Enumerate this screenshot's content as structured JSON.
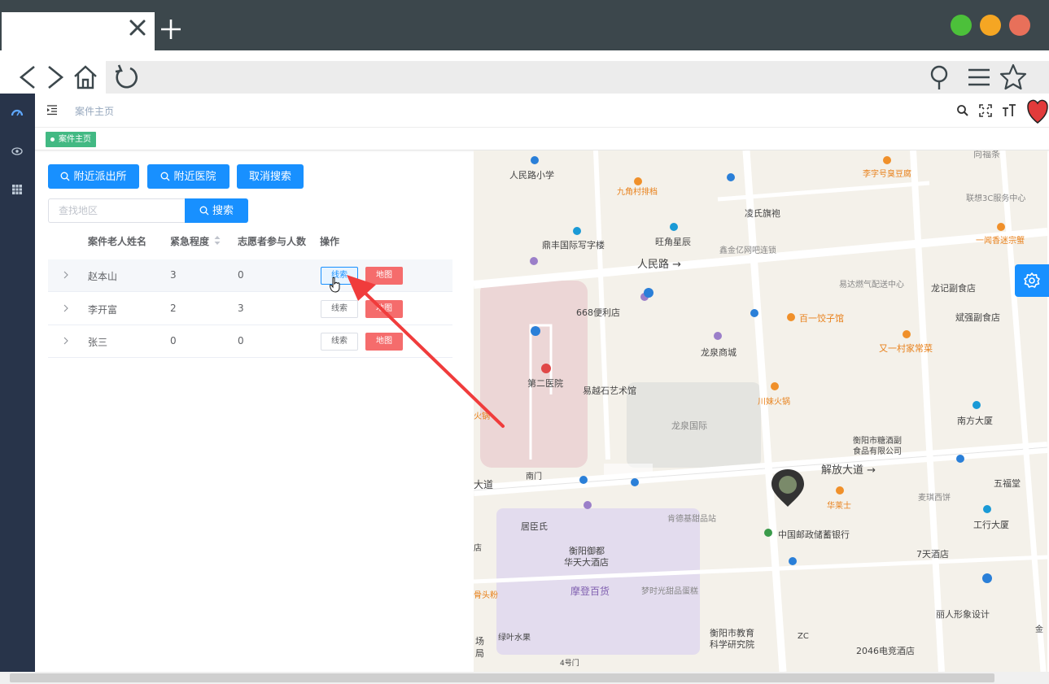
{
  "browser": {
    "tab_title": "",
    "window_controls": {
      "green": "#4cc03a",
      "yellow": "#f5a623",
      "red": "#e8705a"
    }
  },
  "header": {
    "breadcrumb": "案件主页"
  },
  "tags": {
    "active_tag": "案件主页"
  },
  "toolbar": {
    "nearby_police": "附近派出所",
    "nearby_hospital": "附近医院",
    "cancel_search": "取消搜索",
    "search_placeholder": "查找地区",
    "search_button": "搜索"
  },
  "table": {
    "columns": [
      "案件老人姓名",
      "紧急程度",
      "志愿者参与人数",
      "操作"
    ],
    "rows": [
      {
        "name": "赵本山",
        "urgency": "3",
        "volunteers": "0",
        "clue": "线索",
        "map": "地图"
      },
      {
        "name": "李开富",
        "urgency": "2",
        "volunteers": "3",
        "clue": "线索",
        "map": "地图"
      },
      {
        "name": "张三",
        "urgency": "0",
        "volunteers": "0",
        "clue": "线索",
        "map": "地图"
      }
    ]
  },
  "map": {
    "labels": {
      "a": "人民路小学",
      "b": "九角村排档",
      "c": "李字号臭豆腐",
      "d": "凌氏旗袍",
      "e": "联想3C服务中心",
      "f": "鼎丰国际写字楼",
      "g": "旺角星辰",
      "h": "鑫金亿网吧连锁",
      "i": "一闻香迷宗蟹",
      "j": "人民路 →",
      "k": "易达燃气配送中心",
      "l": "龙记副食店",
      "m": "668便利店",
      "n": "百一饺子馆",
      "o": "斌强副食店",
      "p": "龙泉商城",
      "q": "又一村家常菜",
      "r": "第二医院",
      "s": "易越石艺术馆",
      "t": "川妹火锅",
      "u": "龙泉国际",
      "v": "衡阳市糖酒副",
      "w": "食品有限公司",
      "x": "南方大厦",
      "y": "解放大道 →",
      "z": "五福堂",
      "aa": "南门",
      "ab": "大道",
      "ac": "华莱士",
      "ad": "麦琪西饼",
      "ae": "肯德基甜品站",
      "af": "居臣氏",
      "ag": "中国邮政储蓄银行",
      "ah": "工行大厦",
      "ai": "衡阳御都",
      "aj": "华天大酒店",
      "ak": "7天酒店",
      "al": "摩登百货",
      "am": "梦时光甜品蛋糕",
      "an": "骨头粉",
      "ao": "丽人形象设计",
      "ap": "衡阳市教育",
      "aq": "科学研究院",
      "ar": "绿叶水果",
      "as": "4号门",
      "at": "2046电竞酒店",
      "au": "场",
      "av": "局",
      "aw": "店",
      "ax": "向福条",
      "ay": "ZC",
      "az": "金",
      "ba": "火锅"
    }
  },
  "colors": {
    "primary": "#1890ff",
    "danger": "#f56c6c",
    "sidebar": "#28344a",
    "tag": "#42b983"
  }
}
